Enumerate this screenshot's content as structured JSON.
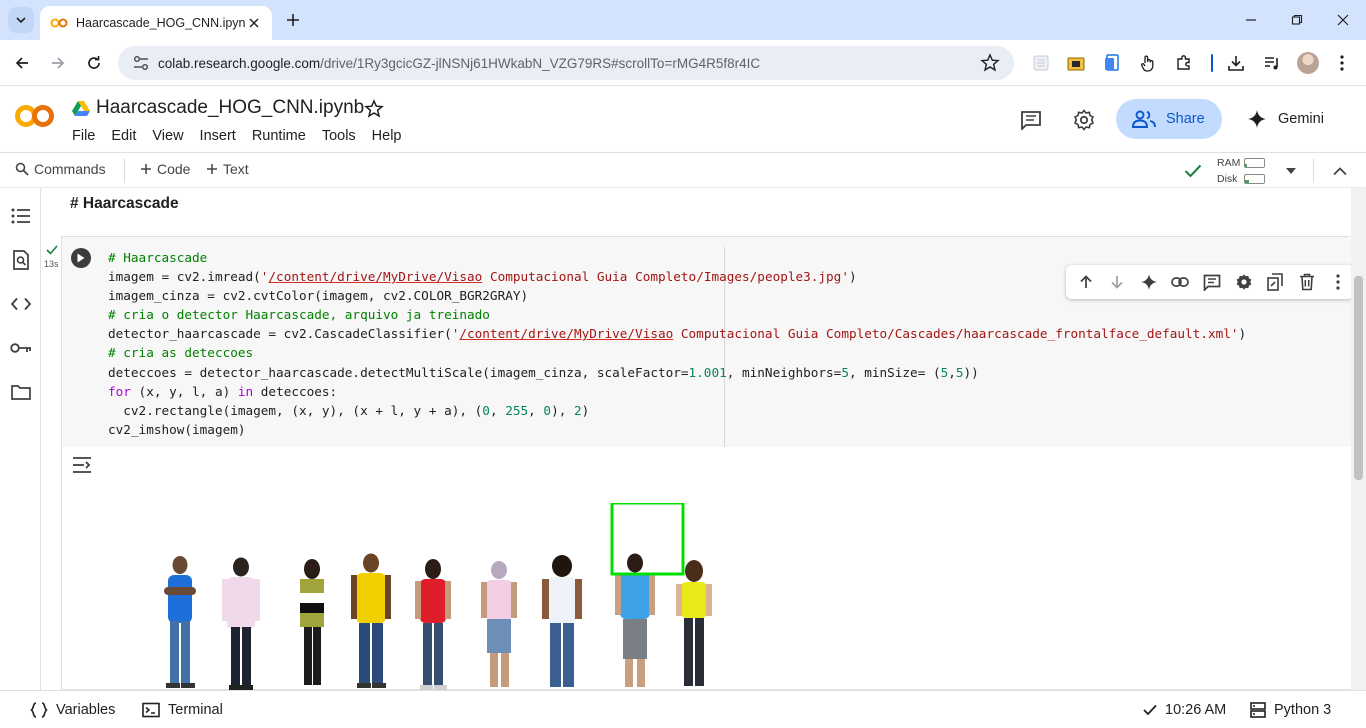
{
  "browser": {
    "tab_title": "Haarcascade_HOG_CNN.ipynb",
    "url_host": "colab.research.google.com",
    "url_path": "/drive/1Ry3gcicGZ-jlNSNj61HWkabN_VZG79RS#scrollTo=rMG4R5f8r4IC"
  },
  "colab": {
    "doc_title": "Haarcascade_HOG_CNN.ipynb",
    "menu": [
      "File",
      "Edit",
      "View",
      "Insert",
      "Runtime",
      "Tools",
      "Help"
    ],
    "share_label": "Share",
    "gemini_label": "Gemini",
    "brand_color": "#f9ab00"
  },
  "toolbar": {
    "commands_label": "Commands",
    "code_label": "Code",
    "text_label": "Text",
    "ram_label": "RAM",
    "disk_label": "Disk",
    "ram_fraction": 0.1,
    "disk_fraction": 0.2
  },
  "notebook": {
    "heading": "# Haarcascade",
    "exec_time": "13s",
    "code_lines": [
      "# Haarcascade",
      "imagem = cv2.imread('/content/drive/MyDrive/Visao Computacional Guia Completo/Images/people3.jpg')",
      "imagem_cinza = cv2.cvtColor(imagem, cv2.COLOR_BGR2GRAY)",
      "# cria o detector Haarcascade, arquivo ja treinado",
      "detector_haarcascade = cv2.CascadeClassifier('/content/drive/MyDrive/Visao Computacional Guia Completo/Cascades/haarcascade_frontalface_default.xml')",
      "# cria as deteccoes",
      "deteccoes = detector_haarcascade.detectMultiScale(imagem_cinza, scaleFactor=1.001, minNeighbors=5, minSize= (5,5))",
      "for (x, y, l, a) in deteccoes:",
      "  cv2.rectangle(imagem, (x, y), (x + l, y + a), (0, 255, 0), 2)",
      "cv2_imshow(imagem)"
    ],
    "detection_box_color": "#00e000"
  },
  "statusbar": {
    "variables_label": "Variables",
    "terminal_label": "Terminal",
    "time": "10:26 AM",
    "runtime": "Python 3"
  }
}
